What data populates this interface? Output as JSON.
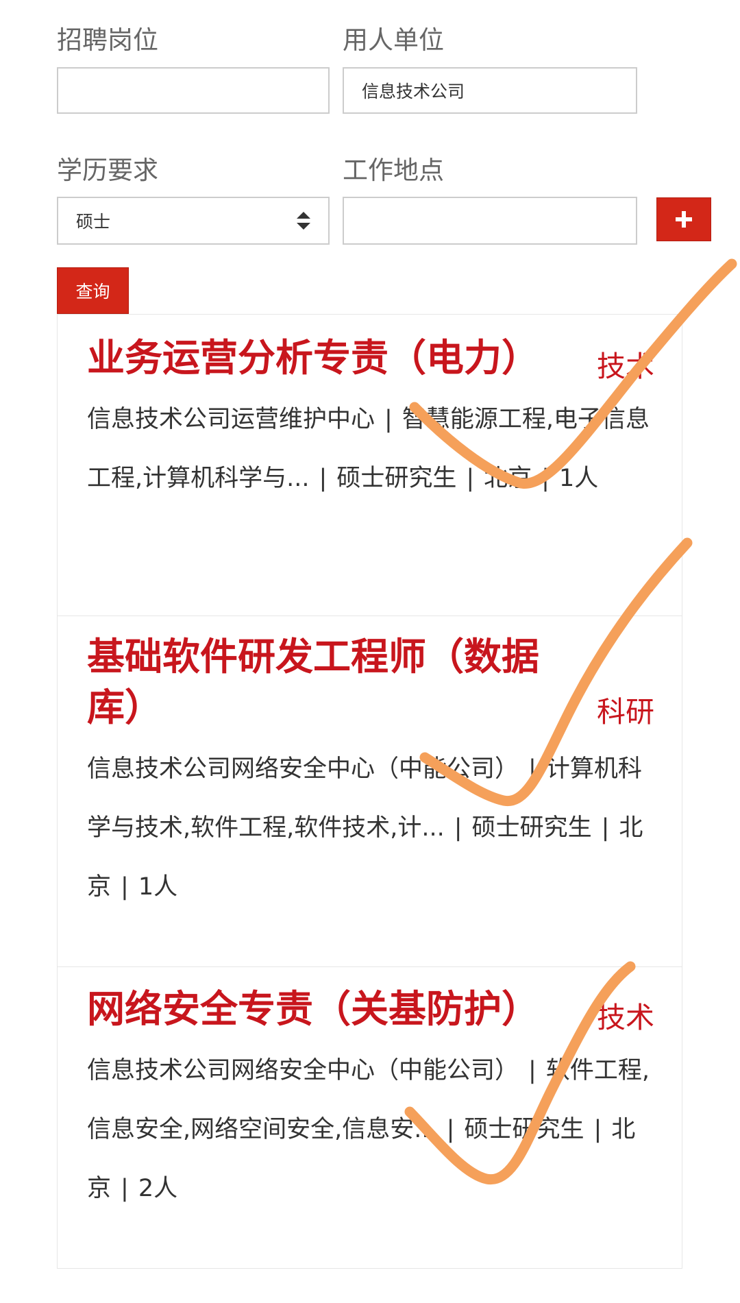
{
  "filters": {
    "position_label": "招聘岗位",
    "position_value": "",
    "employer_label": "用人单位",
    "employer_value": "信息技术公司",
    "education_label": "学历要求",
    "education_value": "硕士",
    "location_label": "工作地点",
    "location_value": "",
    "plus_icon": "plus-icon",
    "query_label": "查询"
  },
  "jobs": [
    {
      "title": "业务运营分析专责（电力）",
      "type": "技术",
      "department": "信息技术公司运营维护中心",
      "majors": "智慧能源工程,电子信息工程,计算机科学与...",
      "education": "硕士研究生",
      "location": "北京",
      "count": "1人"
    },
    {
      "title": "基础软件研发工程师（数据库）",
      "type": "科研",
      "department": "信息技术公司网络安全中心（中能公司）",
      "majors": "计算机科学与技术,软件工程,软件技术,计...",
      "education": "硕士研究生",
      "location": "北京",
      "count": "1人"
    },
    {
      "title": "网络安全专责（关基防护）",
      "type": "技术",
      "department": "信息技术公司网络安全中心（中能公司）",
      "majors": "软件工程,信息安全,网络空间安全,信息安...",
      "education": "硕士研究生",
      "location": "北京",
      "count": "2人"
    }
  ],
  "separator": "|",
  "colors": {
    "accent": "#c8161d",
    "button": "#d32718",
    "check_marks": "#f5a05a"
  }
}
